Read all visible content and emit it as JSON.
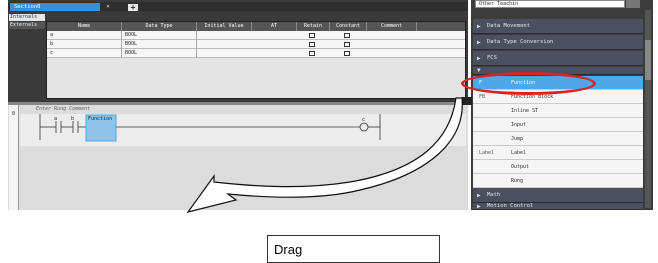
{
  "editor": {
    "tabs": [
      {
        "label": "Section0",
        "close": "×"
      }
    ],
    "add_tab_label": "+",
    "variable_tabs": [
      "Internals",
      "Externals"
    ],
    "table": {
      "columns": [
        "Name",
        "Data Type",
        "Initial Value",
        "AT",
        "Retain",
        "Constant",
        "Comment"
      ],
      "rows": [
        {
          "name": "a",
          "type": "BOOL"
        },
        {
          "name": "b",
          "type": "BOOL"
        },
        {
          "name": "c",
          "type": "BOOL"
        }
      ]
    },
    "ladder": {
      "rung_number": "0",
      "rung_comment": "Enter Rung Comment",
      "contacts": [
        "a",
        "b"
      ],
      "block_label": "Function",
      "coil": "c"
    }
  },
  "palette": {
    "search_value": "Other Teachin",
    "items": [
      {
        "kind": "category",
        "label": "Data Movement"
      },
      {
        "kind": "category",
        "label": "Data Type Conversion"
      },
      {
        "kind": "category",
        "label": "FCS"
      },
      {
        "kind": "category",
        "label": ""
      },
      {
        "kind": "item",
        "icon": "F",
        "label": "Function",
        "selected": true
      },
      {
        "kind": "item",
        "icon": "FB",
        "label": "Function Block"
      },
      {
        "kind": "item",
        "icon": "",
        "label": "Inline ST"
      },
      {
        "kind": "item",
        "icon": "",
        "label": "Input"
      },
      {
        "kind": "item",
        "icon": "",
        "label": "Jump"
      },
      {
        "kind": "item",
        "icon": "Label",
        "label": "Label"
      },
      {
        "kind": "item",
        "icon": "",
        "label": "Output"
      },
      {
        "kind": "item",
        "icon": "",
        "label": "Rung"
      },
      {
        "kind": "category",
        "label": "Math"
      },
      {
        "kind": "category",
        "label": "Motion Control"
      }
    ]
  },
  "annotation": {
    "drag_label": "Drag"
  },
  "colors": {
    "highlight": "#dd2222",
    "selection": "#4ea7e6",
    "block": "#4ea7e6"
  }
}
